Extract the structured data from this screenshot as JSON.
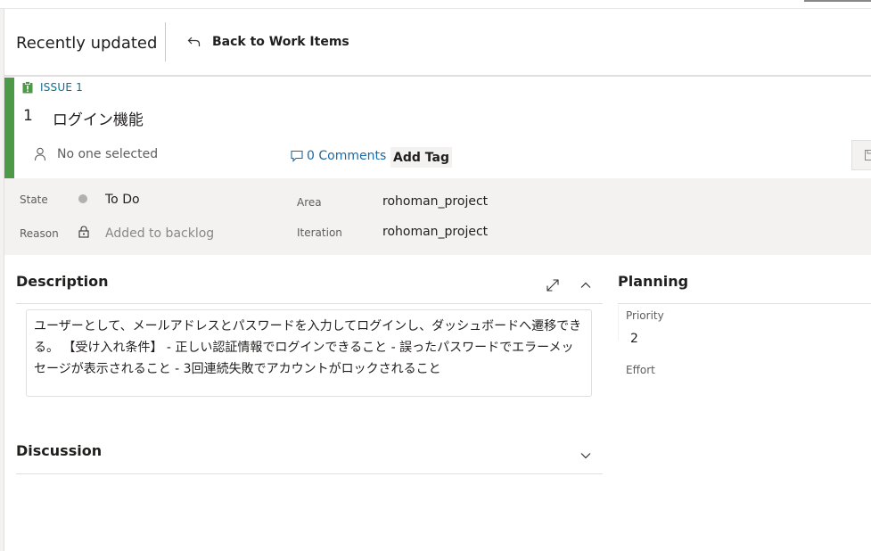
{
  "header": {
    "title": "Recently updated",
    "back_label": "Back to Work Items"
  },
  "work_item": {
    "type_label": "ISSUE 1",
    "id": "1",
    "title": "ログイン機能",
    "assignee": "No one selected",
    "comments_label": "0 Comments",
    "add_tag_label": "Add Tag",
    "accent_color": "#4c9a48"
  },
  "fields": {
    "state_label": "State",
    "state_value": "To Do",
    "reason_label": "Reason",
    "reason_value": "Added to backlog",
    "area_label": "Area",
    "area_value": "rohoman_project",
    "iteration_label": "Iteration",
    "iteration_value": "rohoman_project"
  },
  "description": {
    "title": "Description",
    "text": "ユーザーとして、メールアドレスとパスワードを入力してログインし、ダッシュボードへ遷移できる。 【受け入れ条件】 - 正しい認証情報でログインできること - 誤ったパスワードでエラーメッセージが表示されること - 3回連続失敗でアカウントがロックされること"
  },
  "discussion": {
    "title": "Discussion"
  },
  "planning": {
    "title": "Planning",
    "priority_label": "Priority",
    "priority_value": "2",
    "effort_label": "Effort"
  },
  "icons": {
    "back": "back-arrow-icon",
    "type": "clipboard-icon",
    "assignee": "person-icon",
    "comments": "comment-icon",
    "reason": "lock-icon",
    "expand": "expand-icon",
    "collapse": "chevron-up-icon",
    "discussion_toggle": "chevron-down-icon"
  }
}
